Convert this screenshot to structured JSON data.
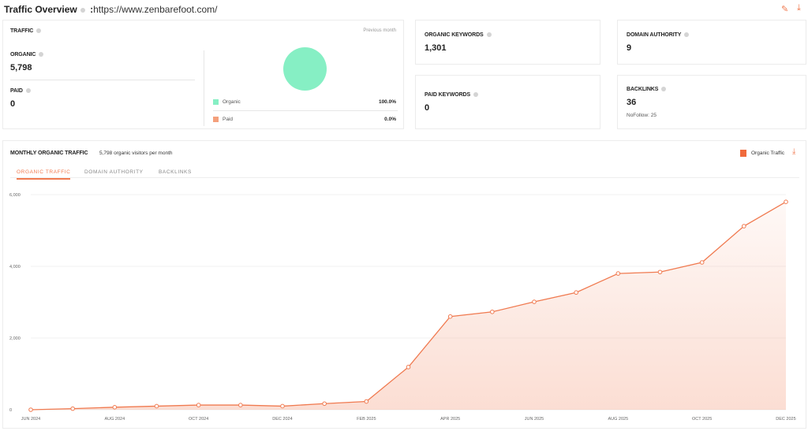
{
  "header": {
    "title": "Traffic Overview",
    "separator": ":",
    "url": "https://www.zenbarefoot.com/",
    "icons": [
      "edit-icon",
      "download-icon"
    ]
  },
  "traffic": {
    "label": "TRAFFIC",
    "period": "Previous month",
    "organic_label": "ORGANIC",
    "organic_value": "5,798",
    "paid_label": "PAID",
    "paid_value": "0",
    "legend": [
      {
        "name": "Organic",
        "pct": "100.0%",
        "color": "#86efc4"
      },
      {
        "name": "Paid",
        "pct": "0.0%",
        "color": "#f4a07c"
      }
    ]
  },
  "stats": {
    "organic_keywords": {
      "label": "ORGANIC KEYWORDS",
      "value": "1,301"
    },
    "domain_authority": {
      "label": "DOMAIN AUTHORITY",
      "value": "9"
    },
    "paid_keywords": {
      "label": "PAID KEYWORDS",
      "value": "0"
    },
    "backlinks": {
      "label": "BACKLINKS",
      "value": "36",
      "nofollow": "NoFollow: 25"
    }
  },
  "monthly": {
    "title": "MONTHLY ORGANIC TRAFFIC",
    "subtitle": "5,798 organic visitors per month",
    "legend": "Organic Traffic",
    "tabs": [
      "ORGANIC TRAFFIC",
      "DOMAIN AUTHORITY",
      "BACKLINKS"
    ],
    "active_tab": 0
  },
  "chart_data": {
    "type": "area",
    "color": "#f07a50",
    "ylim": [
      0,
      6000
    ],
    "yticks": [
      "0",
      "2,000",
      "4,000",
      "6,000"
    ],
    "ytick_values": [
      0,
      2000,
      4000,
      6000
    ],
    "x": [
      "Jun 2024",
      "Jul 2024",
      "Aug 2024",
      "Sep 2024",
      "Oct 2024",
      "Nov 2024",
      "Dec 2024",
      "Jan 2025",
      "Feb 2025",
      "Mar 2025",
      "Apr 2025",
      "May 2025",
      "Jun 2025",
      "Jul 2025",
      "Aug 2025",
      "Sep 2025",
      "Oct 2025",
      "Nov 2025",
      "Dec 2025"
    ],
    "xtick_labels": [
      "JUN 2024",
      "AUG 2024",
      "OCT 2024",
      "DEC 2024",
      "FEB 2025",
      "APR 2025",
      "JUN 2025",
      "AUG 2025",
      "OCT 2025",
      "DEC 2025"
    ],
    "series": [
      {
        "name": "Organic Traffic",
        "values": [
          0,
          30,
          70,
          100,
          130,
          130,
          100,
          170,
          230,
          1190,
          2600,
          2730,
          3010,
          3270,
          3800,
          3840,
          4110,
          5120,
          5798
        ]
      }
    ],
    "grid": true,
    "legend_position": "top-right"
  }
}
